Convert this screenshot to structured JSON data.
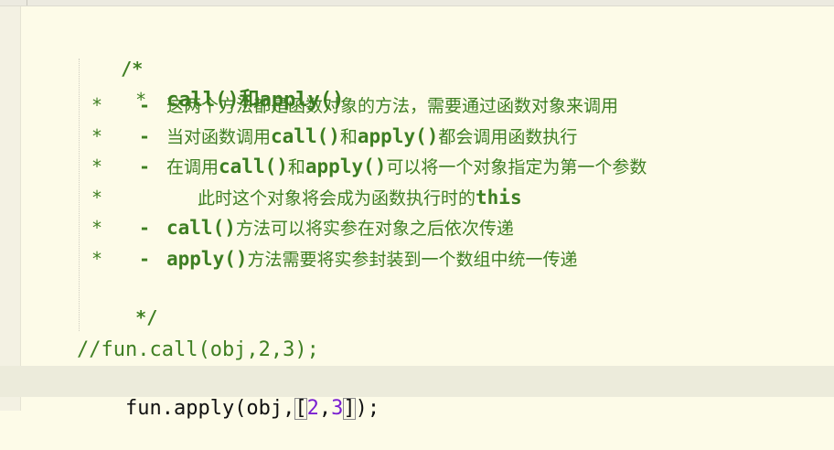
{
  "editor": {
    "comment_block": {
      "open": "/*",
      "star": "*",
      "close": "*/",
      "title": "call()和apply()",
      "items": [
        {
          "dash": "-",
          "segments": [
            {
              "text": "这两个方法都是函数对象的方法，需要通过函数对象来调用",
              "type": "cjk"
            }
          ]
        },
        {
          "dash": "-",
          "segments": [
            {
              "text": "当对函数调用",
              "type": "cjk"
            },
            {
              "text": "call()",
              "type": "code"
            },
            {
              "text": "和",
              "type": "cjk"
            },
            {
              "text": "apply()",
              "type": "code"
            },
            {
              "text": "都会调用函数执行",
              "type": "cjk"
            }
          ]
        },
        {
          "dash": "-",
          "segments": [
            {
              "text": "在调用",
              "type": "cjk"
            },
            {
              "text": "call()",
              "type": "code"
            },
            {
              "text": "和",
              "type": "cjk"
            },
            {
              "text": "apply()",
              "type": "code"
            },
            {
              "text": "可以将一个对象指定为第一个参数",
              "type": "cjk"
            }
          ]
        },
        {
          "dash": "",
          "segments": [
            {
              "text": "此时这个对象将会成为函数执行时的",
              "type": "cjk"
            },
            {
              "text": "this",
              "type": "code"
            }
          ]
        },
        {
          "dash": "-",
          "segments": [
            {
              "text": "call()",
              "type": "code"
            },
            {
              "text": "方法可以将实参在对象之后依次传递",
              "type": "cjk"
            }
          ]
        },
        {
          "dash": "-",
          "segments": [
            {
              "text": "apply()",
              "type": "code"
            },
            {
              "text": "方法需要将实参封装到一个数组中统一传递",
              "type": "cjk"
            }
          ]
        }
      ]
    },
    "line_comment": "//fun.call(obj,2,3);",
    "code": {
      "prefix": "fun.apply(obj,",
      "bracket_open": "[",
      "num1": "2",
      "comma": ",",
      "num2": "3",
      "bracket_close": "]",
      "suffix": ");"
    }
  }
}
